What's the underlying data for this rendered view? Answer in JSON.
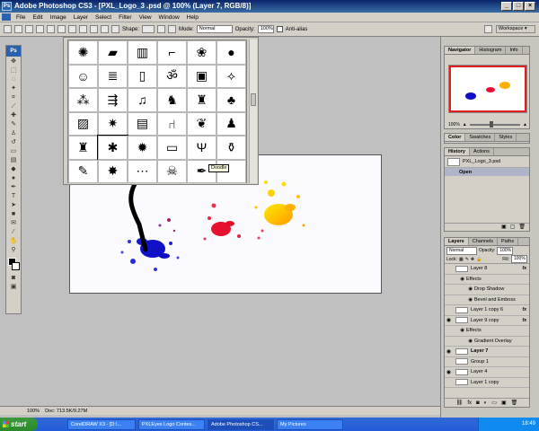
{
  "window": {
    "title": "Adobe Photoshop CS3 - [PXL_Logo_3 .psd @ 100% (Layer 7, RGB/8)]",
    "app_icon": "Ps"
  },
  "menu": [
    "File",
    "Edit",
    "Image",
    "Layer",
    "Select",
    "Filter",
    "View",
    "Window",
    "Help"
  ],
  "options_bar": {
    "shape_label": "Shape:",
    "mode_label": "Mode:",
    "mode_value": "Normal",
    "opacity_label": "Opacity:",
    "opacity_value": "100%",
    "antialias_label": "Anti-alias",
    "workspace_label": "Workspace ▾"
  },
  "brush_picker": {
    "tooltip": "Doodle",
    "cell_icons": [
      "splatter",
      "clapper",
      "building",
      "pistol",
      "brain",
      "sphere",
      "face",
      "bars",
      "ruler",
      "swirl",
      "square-target",
      "branch",
      "dots",
      "arrows",
      "guitarist",
      "dancer",
      "skater",
      "tree",
      "hatch",
      "star-burst",
      "keyboard",
      "chair",
      "heart-face",
      "figure",
      "cupid",
      "doodle",
      "sun-splat",
      "truck",
      "tree-bare",
      "bottles",
      "scribble-text",
      "sunburst",
      "dots-row",
      "skull",
      "graffiti-text",
      "blank"
    ]
  },
  "navigator_panel": {
    "tabs": [
      "Navigator",
      "Histogram",
      "Info"
    ],
    "zoom": "100%"
  },
  "color_panel": {
    "tabs": [
      "Color",
      "Swatches",
      "Styles"
    ]
  },
  "history_panel": {
    "tabs": [
      "History",
      "Actions"
    ],
    "doc_name": "PXL_Logo_3.psd",
    "state": "Open"
  },
  "layers_panel": {
    "tabs": [
      "Layers",
      "Channels",
      "Paths"
    ],
    "blend_mode": "Normal",
    "opacity_label": "Opacity:",
    "opacity_value": "100%",
    "lock_label": "Lock:",
    "fill_label": "Fill:",
    "fill_value": "100%",
    "rows": [
      {
        "name": "Layer 8",
        "fx": "fx",
        "visible": false,
        "indent": 0,
        "selected": false
      },
      {
        "name": "Effects",
        "fx": "",
        "visible": false,
        "indent": 1,
        "selected": false
      },
      {
        "name": "Drop Shadow",
        "fx": "",
        "visible": false,
        "indent": 2,
        "selected": false
      },
      {
        "name": "Bevel and Emboss",
        "fx": "",
        "visible": false,
        "indent": 2,
        "selected": false
      },
      {
        "name": "Layer 1 copy 6",
        "fx": "fx",
        "visible": false,
        "indent": 0,
        "selected": false
      },
      {
        "name": "Layer 9 copy",
        "fx": "fx",
        "visible": true,
        "indent": 0,
        "selected": false
      },
      {
        "name": "Effects",
        "fx": "",
        "visible": false,
        "indent": 1,
        "selected": false
      },
      {
        "name": "Gradient Overlay",
        "fx": "",
        "visible": false,
        "indent": 2,
        "selected": false
      },
      {
        "name": "Layer 7",
        "fx": "",
        "visible": true,
        "indent": 0,
        "selected": true
      },
      {
        "name": "Group 1",
        "fx": "",
        "visible": false,
        "indent": 0,
        "selected": false
      },
      {
        "name": "Layer 4",
        "fx": "",
        "visible": true,
        "indent": 0,
        "selected": false
      },
      {
        "name": "Layer 1 copy",
        "fx": "",
        "visible": false,
        "indent": 0,
        "selected": false
      }
    ]
  },
  "status_bar": {
    "zoom": "100%",
    "doc_info": "Doc: 713.5K/9.27M"
  },
  "taskbar": {
    "start": "start",
    "tasks": [
      "CorelDRAW X3 - [D:\\...",
      "PXLEyes Logo Contes...",
      "Adobe Photoshop CS...",
      "My Pictures"
    ],
    "clock": "18:49"
  },
  "colors": {
    "titlebar": "#0a246a",
    "splat_blue": "#1010c8",
    "splat_red": "#e81030",
    "splat_yellow": "#ffc000"
  }
}
